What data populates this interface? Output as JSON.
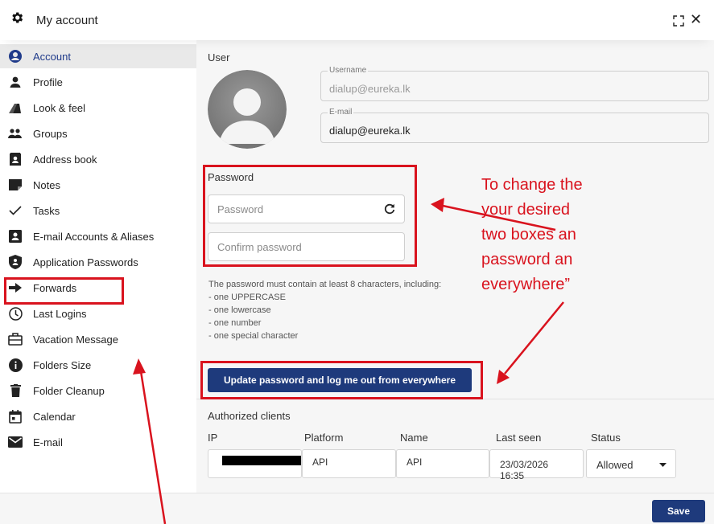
{
  "window": {
    "title": "My account"
  },
  "sidebar": {
    "items": [
      {
        "label": "Account",
        "icon": "account-circle-icon"
      },
      {
        "label": "Profile",
        "icon": "person-icon"
      },
      {
        "label": "Look & feel",
        "icon": "palette-icon"
      },
      {
        "label": "Groups",
        "icon": "groups-icon"
      },
      {
        "label": "Address book",
        "icon": "address-book-icon"
      },
      {
        "label": "Notes",
        "icon": "note-icon"
      },
      {
        "label": "Tasks",
        "icon": "check-icon"
      },
      {
        "label": "E-mail Accounts & Aliases",
        "icon": "contact-card-icon"
      },
      {
        "label": "Application Passwords",
        "icon": "shield-icon"
      },
      {
        "label": "Forwards",
        "icon": "arrow-right-icon"
      },
      {
        "label": "Last Logins",
        "icon": "clock-icon"
      },
      {
        "label": "Vacation Message",
        "icon": "suitcase-icon"
      },
      {
        "label": "Folders Size",
        "icon": "info-icon"
      },
      {
        "label": "Folder Cleanup",
        "icon": "trash-icon"
      },
      {
        "label": "Calendar",
        "icon": "calendar-icon"
      },
      {
        "label": "E-mail",
        "icon": "mail-icon"
      }
    ]
  },
  "user": {
    "section_label": "User",
    "username_label": "Username",
    "username_value": "dialup@eureka.lk",
    "email_label": "E-mail",
    "email_value": "dialup@eureka.lk"
  },
  "password": {
    "section_label": "Password",
    "password_placeholder": "Password",
    "confirm_placeholder": "Confirm password",
    "rules": [
      "The password must contain at least 8 characters, including:",
      "- one UPPERCASE",
      "- one lowercase",
      "- one number",
      "- one special character"
    ],
    "update_button": "Update password and log me out from everywhere"
  },
  "clients": {
    "section_label": "Authorized clients",
    "headers": [
      "IP",
      "Platform",
      "Name",
      "Last seen",
      "Status"
    ],
    "row": {
      "ip_visible": "",
      "platform": "API",
      "name": "API",
      "last_seen_date": "23/03/2026",
      "last_seen_time": "16:35",
      "status": "Allowed"
    }
  },
  "footer": {
    "save_label": "Save"
  },
  "annotation": {
    "lines": [
      "To change the",
      "your desired",
      "two boxes an",
      "password an",
      "everywhere”"
    ],
    "color": "#d9131e"
  },
  "colors": {
    "accent": "#1e3a7c",
    "annotation": "#d9131e"
  }
}
